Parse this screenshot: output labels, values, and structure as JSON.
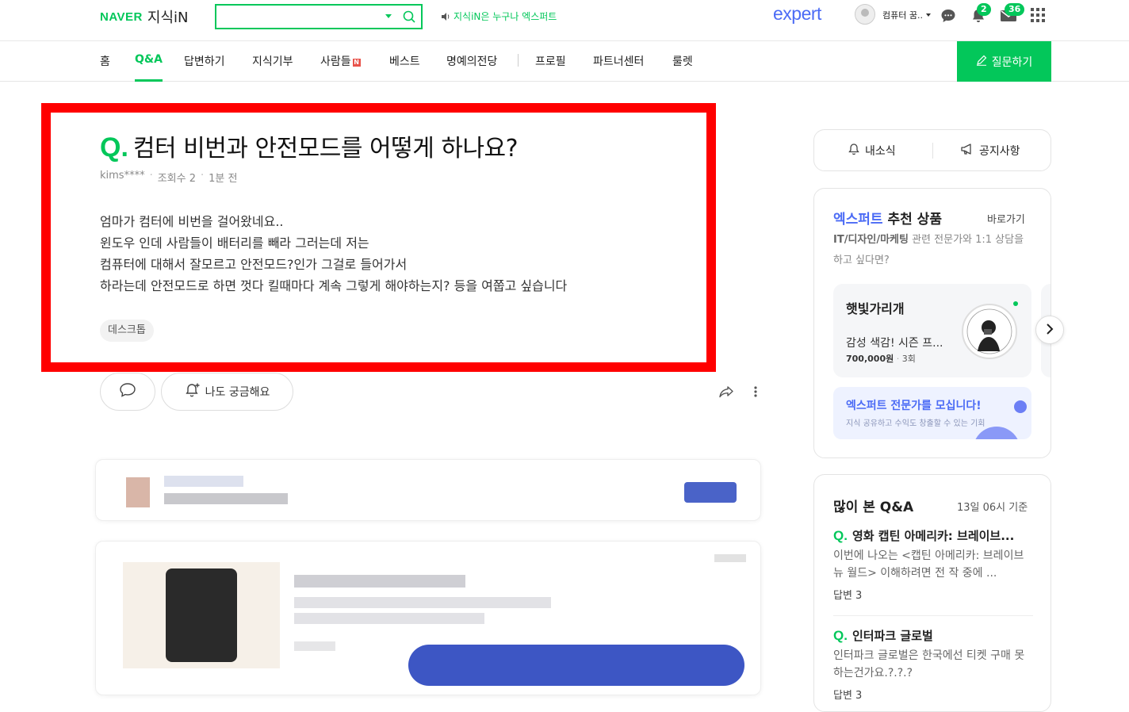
{
  "header": {
    "logo_naver": "NAVER",
    "logo_service": "지식iN",
    "search_value": "",
    "promo_text": "지식iN은 누구나 엑스퍼트",
    "expert_logo": "expert",
    "user_name": "컴퓨터 꿈..",
    "notification_count": "2",
    "mail_count": "36"
  },
  "nav": {
    "items": [
      "홈",
      "Q&A",
      "답변하기",
      "지식기부",
      "사람들",
      "베스트",
      "명예의전당",
      "프로필",
      "파트너센터",
      "룰렛"
    ],
    "new_badge": "N",
    "active": "Q&A",
    "ask_button": "질문하기"
  },
  "question": {
    "mark": "Q.",
    "title": "컴터 비번과 안전모드를 어떻게 하나요?",
    "author": "kims****",
    "views": "조회수 2",
    "time": "1분 전",
    "body": [
      "엄마가 컴터에 비번을 걸어왔네요..",
      "윈도우 인데 사람들이 배터리를 빼라 그러는데 저는",
      "컴퓨터에 대해서 잘모르고 안전모드?인가 그걸로 들어가서",
      "하라는데 안전모드로 하면 껏다 킬때마다 계속 그렇게 해야하는지? 등을 여쭙고 싶습니다"
    ],
    "tag": "데스크톱",
    "curious_label": "나도 궁금해요"
  },
  "sidebar": {
    "notice": {
      "my_news": "내소식",
      "announcements": "공지사항"
    },
    "expert": {
      "title_blue": "엑스퍼트",
      "title_rest": " 추천 상품",
      "link": "바로가기",
      "desc_bold": "IT/디자인/마케팅",
      "desc_rest": " 관련 전문가와 1:1 상담을 하고 싶다면?",
      "card_name": "햇빛가리개",
      "card_product": "감성 색감! 시즌 프...",
      "card_price": "700,000원",
      "card_sessions": "3회",
      "banner_title": "엑스퍼트 전문가를 모십니다!",
      "banner_sub": "지식 공유하고 수익도 창출할 수 있는 기회"
    },
    "popular": {
      "title": "많이 본 Q&A",
      "time": "13일 06시 기준",
      "items": [
        {
          "q": "영화 캡틴 아메리카: 브레이브...",
          "a": "이번에 나오는 <캡틴 아메리카: 브레이브 뉴 월드> 이해하려면 전 작 중에 ...",
          "count": "답변 3"
        },
        {
          "q": "인터파크 글로벌",
          "a": "인터파크 글로벌은 한국에선 티켓 구매 못하는건가요.?.?.?",
          "count": "답변 3"
        }
      ]
    }
  },
  "colors": {
    "brand": "#03c75a",
    "expert": "#4b6bf5",
    "highlight": "#ff0000"
  }
}
